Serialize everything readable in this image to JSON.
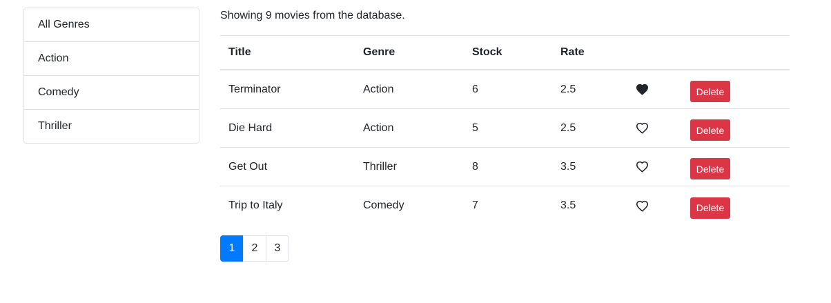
{
  "genres": [
    {
      "label": "All Genres"
    },
    {
      "label": "Action"
    },
    {
      "label": "Comedy"
    },
    {
      "label": "Thriller"
    }
  ],
  "summary": "Showing 9 movies from the database.",
  "table": {
    "headers": [
      "Title",
      "Genre",
      "Stock",
      "Rate"
    ],
    "rows": [
      {
        "title": "Terminator",
        "genre": "Action",
        "stock": "6",
        "rate": "2.5",
        "liked": true,
        "delete_label": "Delete"
      },
      {
        "title": "Die Hard",
        "genre": "Action",
        "stock": "5",
        "rate": "2.5",
        "liked": false,
        "delete_label": "Delete"
      },
      {
        "title": "Get Out",
        "genre": "Thriller",
        "stock": "8",
        "rate": "3.5",
        "liked": false,
        "delete_label": "Delete"
      },
      {
        "title": "Trip to Italy",
        "genre": "Comedy",
        "stock": "7",
        "rate": "3.5",
        "liked": false,
        "delete_label": "Delete"
      }
    ]
  },
  "pagination": {
    "pages": [
      "1",
      "2",
      "3"
    ],
    "current": "1"
  },
  "icons": {
    "like": "heart-icon"
  },
  "colors": {
    "primary": "#007bff",
    "danger": "#dc3545"
  }
}
